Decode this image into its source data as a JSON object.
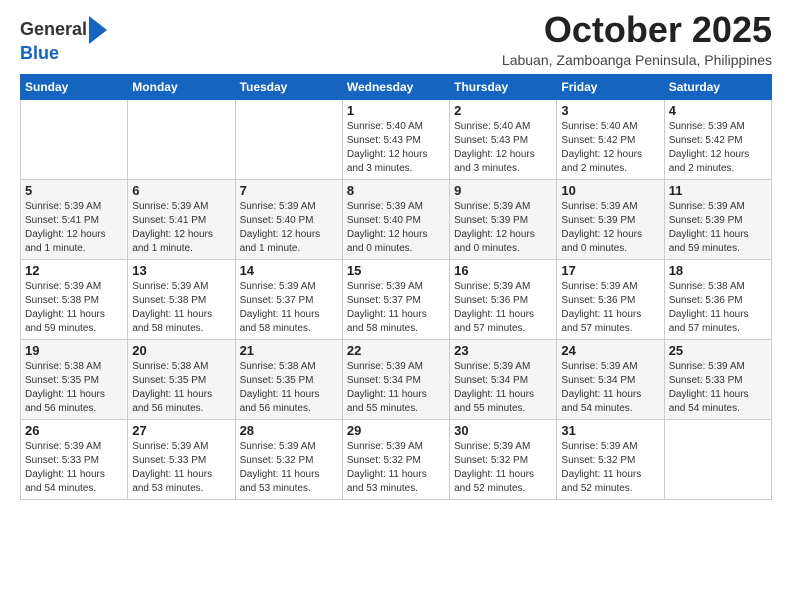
{
  "header": {
    "logo_general": "General",
    "logo_blue": "Blue",
    "month_title": "October 2025",
    "location": "Labuan, Zamboanga Peninsula, Philippines"
  },
  "weekdays": [
    "Sunday",
    "Monday",
    "Tuesday",
    "Wednesday",
    "Thursday",
    "Friday",
    "Saturday"
  ],
  "weeks": [
    [
      {
        "day": "",
        "info": ""
      },
      {
        "day": "",
        "info": ""
      },
      {
        "day": "",
        "info": ""
      },
      {
        "day": "1",
        "info": "Sunrise: 5:40 AM\nSunset: 5:43 PM\nDaylight: 12 hours\nand 3 minutes."
      },
      {
        "day": "2",
        "info": "Sunrise: 5:40 AM\nSunset: 5:43 PM\nDaylight: 12 hours\nand 3 minutes."
      },
      {
        "day": "3",
        "info": "Sunrise: 5:40 AM\nSunset: 5:42 PM\nDaylight: 12 hours\nand 2 minutes."
      },
      {
        "day": "4",
        "info": "Sunrise: 5:39 AM\nSunset: 5:42 PM\nDaylight: 12 hours\nand 2 minutes."
      }
    ],
    [
      {
        "day": "5",
        "info": "Sunrise: 5:39 AM\nSunset: 5:41 PM\nDaylight: 12 hours\nand 1 minute."
      },
      {
        "day": "6",
        "info": "Sunrise: 5:39 AM\nSunset: 5:41 PM\nDaylight: 12 hours\nand 1 minute."
      },
      {
        "day": "7",
        "info": "Sunrise: 5:39 AM\nSunset: 5:40 PM\nDaylight: 12 hours\nand 1 minute."
      },
      {
        "day": "8",
        "info": "Sunrise: 5:39 AM\nSunset: 5:40 PM\nDaylight: 12 hours\nand 0 minutes."
      },
      {
        "day": "9",
        "info": "Sunrise: 5:39 AM\nSunset: 5:39 PM\nDaylight: 12 hours\nand 0 minutes."
      },
      {
        "day": "10",
        "info": "Sunrise: 5:39 AM\nSunset: 5:39 PM\nDaylight: 12 hours\nand 0 minutes."
      },
      {
        "day": "11",
        "info": "Sunrise: 5:39 AM\nSunset: 5:39 PM\nDaylight: 11 hours\nand 59 minutes."
      }
    ],
    [
      {
        "day": "12",
        "info": "Sunrise: 5:39 AM\nSunset: 5:38 PM\nDaylight: 11 hours\nand 59 minutes."
      },
      {
        "day": "13",
        "info": "Sunrise: 5:39 AM\nSunset: 5:38 PM\nDaylight: 11 hours\nand 58 minutes."
      },
      {
        "day": "14",
        "info": "Sunrise: 5:39 AM\nSunset: 5:37 PM\nDaylight: 11 hours\nand 58 minutes."
      },
      {
        "day": "15",
        "info": "Sunrise: 5:39 AM\nSunset: 5:37 PM\nDaylight: 11 hours\nand 58 minutes."
      },
      {
        "day": "16",
        "info": "Sunrise: 5:39 AM\nSunset: 5:36 PM\nDaylight: 11 hours\nand 57 minutes."
      },
      {
        "day": "17",
        "info": "Sunrise: 5:39 AM\nSunset: 5:36 PM\nDaylight: 11 hours\nand 57 minutes."
      },
      {
        "day": "18",
        "info": "Sunrise: 5:38 AM\nSunset: 5:36 PM\nDaylight: 11 hours\nand 57 minutes."
      }
    ],
    [
      {
        "day": "19",
        "info": "Sunrise: 5:38 AM\nSunset: 5:35 PM\nDaylight: 11 hours\nand 56 minutes."
      },
      {
        "day": "20",
        "info": "Sunrise: 5:38 AM\nSunset: 5:35 PM\nDaylight: 11 hours\nand 56 minutes."
      },
      {
        "day": "21",
        "info": "Sunrise: 5:38 AM\nSunset: 5:35 PM\nDaylight: 11 hours\nand 56 minutes."
      },
      {
        "day": "22",
        "info": "Sunrise: 5:39 AM\nSunset: 5:34 PM\nDaylight: 11 hours\nand 55 minutes."
      },
      {
        "day": "23",
        "info": "Sunrise: 5:39 AM\nSunset: 5:34 PM\nDaylight: 11 hours\nand 55 minutes."
      },
      {
        "day": "24",
        "info": "Sunrise: 5:39 AM\nSunset: 5:34 PM\nDaylight: 11 hours\nand 54 minutes."
      },
      {
        "day": "25",
        "info": "Sunrise: 5:39 AM\nSunset: 5:33 PM\nDaylight: 11 hours\nand 54 minutes."
      }
    ],
    [
      {
        "day": "26",
        "info": "Sunrise: 5:39 AM\nSunset: 5:33 PM\nDaylight: 11 hours\nand 54 minutes."
      },
      {
        "day": "27",
        "info": "Sunrise: 5:39 AM\nSunset: 5:33 PM\nDaylight: 11 hours\nand 53 minutes."
      },
      {
        "day": "28",
        "info": "Sunrise: 5:39 AM\nSunset: 5:32 PM\nDaylight: 11 hours\nand 53 minutes."
      },
      {
        "day": "29",
        "info": "Sunrise: 5:39 AM\nSunset: 5:32 PM\nDaylight: 11 hours\nand 53 minutes."
      },
      {
        "day": "30",
        "info": "Sunrise: 5:39 AM\nSunset: 5:32 PM\nDaylight: 11 hours\nand 52 minutes."
      },
      {
        "day": "31",
        "info": "Sunrise: 5:39 AM\nSunset: 5:32 PM\nDaylight: 11 hours\nand 52 minutes."
      },
      {
        "day": "",
        "info": ""
      }
    ]
  ]
}
